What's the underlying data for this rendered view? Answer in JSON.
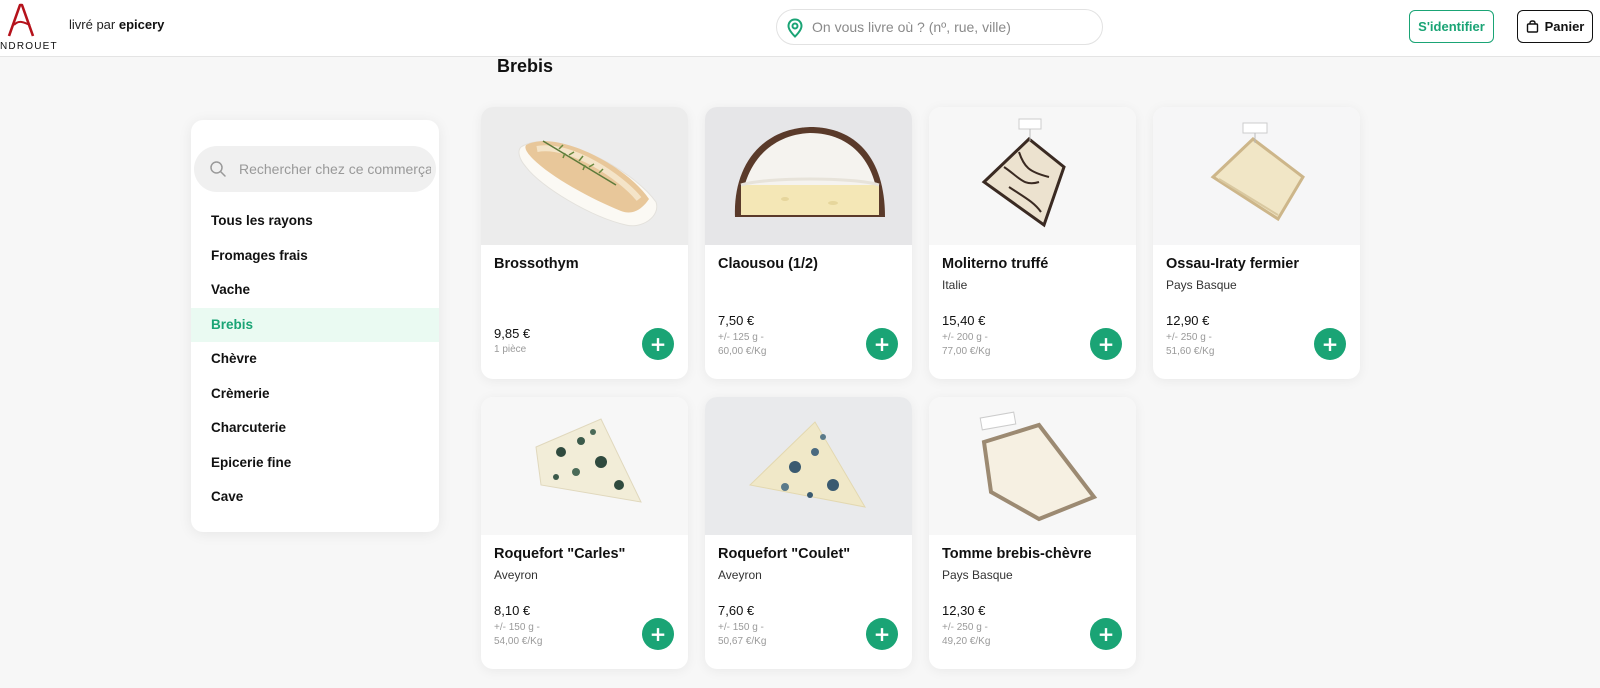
{
  "header": {
    "logo_text": "NDROUET",
    "delivered_prefix": "livré par",
    "delivered_brand": "epicery",
    "address_placeholder": "On vous livre où ? (nº, rue, ville)",
    "login_label": "S'identifier",
    "cart_label": "Panier",
    "accent": "#1aa475",
    "logo_color": "#b5121b"
  },
  "section_title": "Brebis",
  "sidebar": {
    "search_placeholder": "Rechercher chez ce commerçant",
    "categories": [
      {
        "label": "Tous les rayons",
        "active": false
      },
      {
        "label": "Fromages frais",
        "active": false
      },
      {
        "label": "Vache",
        "active": false
      },
      {
        "label": "Brebis",
        "active": true
      },
      {
        "label": "Chèvre",
        "active": false
      },
      {
        "label": "Crèmerie",
        "active": false
      },
      {
        "label": "Charcuterie",
        "active": false
      },
      {
        "label": "Epicerie fine",
        "active": false
      },
      {
        "label": "Cave",
        "active": false
      }
    ]
  },
  "products": [
    {
      "name": "Brossothym",
      "origin": "",
      "price": "9,85 €",
      "info_1": "1 pièce",
      "info_2": "",
      "image": "soft-rind-cheese-with-thyme"
    },
    {
      "name": "Claousou (1/2)",
      "origin": "",
      "price": "7,50 €",
      "info_1": "+/- 125 g -",
      "info_2": "60,00 €/Kg",
      "image": "half-round-soft-cheese"
    },
    {
      "name": "Moliterno truffé",
      "origin": "Italie",
      "price": "15,40 €",
      "info_1": "+/- 200 g -",
      "info_2": "77,00 €/Kg",
      "image": "truffle-veined-cheese-wedge"
    },
    {
      "name": "Ossau-Iraty fermier",
      "origin": "Pays Basque",
      "price": "12,90 €",
      "info_1": "+/- 250 g -",
      "info_2": "51,60 €/Kg",
      "image": "pale-cheese-wedge"
    },
    {
      "name": "Roquefort \"Carles\"",
      "origin": "Aveyron",
      "price": "8,10 €",
      "info_1": "+/- 150 g -",
      "info_2": "54,00 €/Kg",
      "image": "blue-cheese-wedge"
    },
    {
      "name": "Roquefort \"Coulet\"",
      "origin": "Aveyron",
      "price": "7,60 €",
      "info_1": "+/- 150 g -",
      "info_2": "50,67 €/Kg",
      "image": "blue-cheese-wedge"
    },
    {
      "name": "Tomme brebis-chèvre",
      "origin": "Pays Basque",
      "price": "12,30 €",
      "info_1": "+/- 250 g -",
      "info_2": "49,20 €/Kg",
      "image": "tomme-cheese-wedge"
    }
  ],
  "add_label": "+"
}
